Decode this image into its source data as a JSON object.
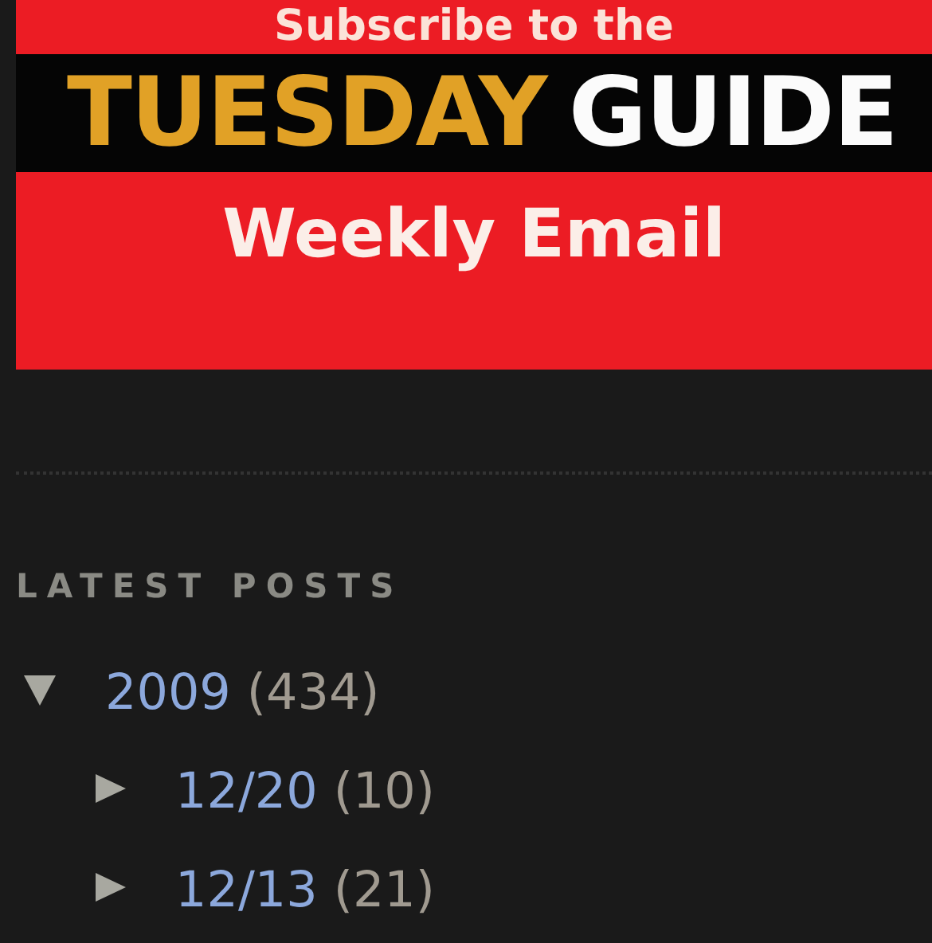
{
  "banner": {
    "top_line": "Subscribe to the",
    "title_first": "TUESDAY",
    "title_second": "GUIDE",
    "bottom_line": "Weekly Email"
  },
  "archive": {
    "heading": "LATEST POSTS",
    "items": [
      {
        "label": "2009",
        "count": "(434)",
        "expanded": true,
        "children": [
          {
            "label": "12/20",
            "count": "(10)",
            "expanded": false
          },
          {
            "label": "12/13",
            "count": "(21)",
            "expanded": false
          }
        ]
      }
    ]
  }
}
